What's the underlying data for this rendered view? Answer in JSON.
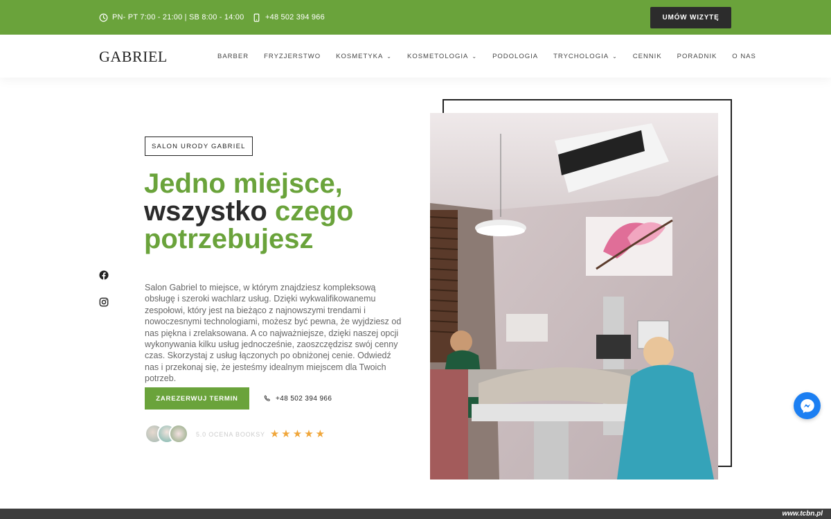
{
  "topbar": {
    "hours": "PN- PT 7:00 - 21:00 | SB 8:00 - 14:00",
    "phone": "+48 502 394 966",
    "cta": "UMÓW WIZYTĘ",
    "bg_color": "#6aa33b"
  },
  "header": {
    "logo": "GABRIEL",
    "nav": [
      {
        "label": "BARBER"
      },
      {
        "label": "FRYZJERSTWO"
      },
      {
        "label": "KOSMETYKA",
        "dropdown": true
      },
      {
        "label": "KOSMETOLOGIA",
        "dropdown": true
      },
      {
        "label": "PODOLOGIA"
      },
      {
        "label": "TRYCHOLOGIA",
        "dropdown": true
      },
      {
        "label": "CENNIK"
      },
      {
        "label": "PORADNIK"
      },
      {
        "label": "O NAS"
      }
    ]
  },
  "social": {
    "facebook": "facebook-icon",
    "instagram": "instagram-icon"
  },
  "hero": {
    "tag": "SALON URODY GABRIEL",
    "headline_1": "Jedno miejsce,",
    "headline_2a": "wszystko",
    "headline_2b": " czego",
    "headline_3": "potrzebujesz",
    "description": "Salon Gabriel to miejsce, w którym znajdziesz kompleksową obsługę i szeroki wachlarz usług. Dzięki wykwalifikowanemu zespołowi, który jest na bieżąco z najnowszymi trendami i nowoczesnymi technologiami, możesz być pewna, że wyjdziesz od nas piękna i zrelaksowana. A co najważniejsze, dzięki naszej opcji wykonywania kilku usług jednocześnie, zaoszczędzisz swój cenny czas. Skorzystaj z usług łączonych po obniżonej cenie. Odwiedź nas i przekonaj się, że jesteśmy idealnym miejscem dla Twoich potrzeb.",
    "reserve_button": "ZAREZERWUJ TERMIN",
    "phone": "+48 502 394 966",
    "rating_text": "5.0 OCENA BOOKSY",
    "stars": 5,
    "accent_color": "#6aa33b"
  },
  "watermark": "www.tcbn.pl"
}
